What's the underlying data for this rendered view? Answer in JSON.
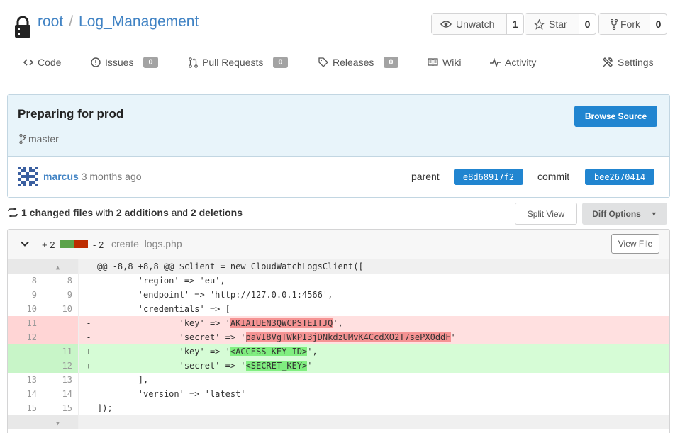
{
  "repo": {
    "owner": "root",
    "separator": "/",
    "name": "Log_Management"
  },
  "actions": {
    "watch": {
      "label": "Unwatch",
      "count": "1"
    },
    "star": {
      "label": "Star",
      "count": "0"
    },
    "fork": {
      "label": "Fork",
      "count": "0"
    }
  },
  "nav": {
    "code": "Code",
    "issues": {
      "label": "Issues",
      "count": "0"
    },
    "pulls": {
      "label": "Pull Requests",
      "count": "0"
    },
    "releases": {
      "label": "Releases",
      "count": "0"
    },
    "wiki": "Wiki",
    "activity": "Activity",
    "settings": "Settings"
  },
  "commit": {
    "title": "Preparing for prod",
    "branch": "master",
    "browse_label": "Browse Source",
    "author": "marcus",
    "time": "3 months ago",
    "parent_label": "parent",
    "parent_sha": "e8d68917f2",
    "commit_label": "commit",
    "commit_sha": "bee2670414"
  },
  "stats": {
    "files": "1 changed files",
    "with": "with",
    "additions": "2 additions",
    "and": "and",
    "deletions": "2 deletions",
    "split_view": "Split View",
    "diff_options": "Diff Options"
  },
  "file": {
    "add_count": "+ 2",
    "del_count": "- 2",
    "name": "create_logs.php",
    "view_file": "View File",
    "hunk": "@@ -8,8 +8,8 @@ $client = new CloudWatchLogsClient([",
    "lines": [
      {
        "old": "8",
        "new": "8",
        "sign": "",
        "pre": "        'region' => 'eu',",
        "hl": "",
        "post": ""
      },
      {
        "old": "9",
        "new": "9",
        "sign": "",
        "pre": "        'endpoint' => 'http://127.0.0.1:4566',",
        "hl": "",
        "post": ""
      },
      {
        "old": "10",
        "new": "10",
        "sign": "",
        "pre": "        'credentials' => [",
        "hl": "",
        "post": ""
      },
      {
        "old": "11",
        "new": "",
        "sign": "-",
        "pre": "                'key' => '",
        "hl": "AKIAIUEN3QWCPSTEITJQ",
        "post": "',"
      },
      {
        "old": "12",
        "new": "",
        "sign": "-",
        "pre": "                'secret' => '",
        "hl": "paVI8VgTWkPI3jDNkdzUMvK4CcdXO2T7sePX0ddF",
        "post": "'"
      },
      {
        "old": "",
        "new": "11",
        "sign": "+",
        "pre": "                'key' => '",
        "hl": "<ACCESS_KEY_ID>",
        "post": "',"
      },
      {
        "old": "",
        "new": "12",
        "sign": "+",
        "pre": "                'secret' => '",
        "hl": "<SECRET_KEY>",
        "post": "'"
      },
      {
        "old": "13",
        "new": "13",
        "sign": "",
        "pre": "        ],",
        "hl": "",
        "post": ""
      },
      {
        "old": "14",
        "new": "14",
        "sign": "",
        "pre": "        'version' => 'latest'",
        "hl": "",
        "post": ""
      },
      {
        "old": "15",
        "new": "15",
        "sign": "",
        "pre": "]);",
        "hl": "",
        "post": ""
      }
    ]
  }
}
